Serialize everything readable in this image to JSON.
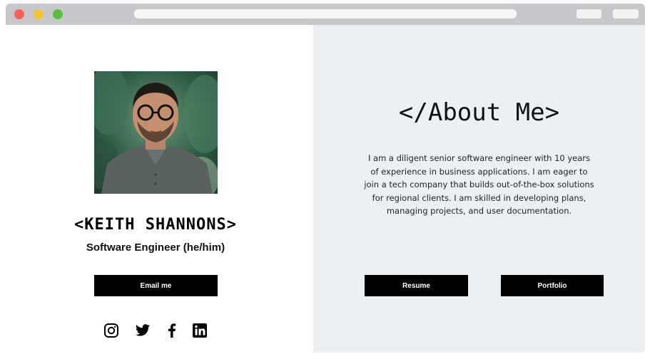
{
  "profile": {
    "name": "<KEITH SHANNONS>",
    "role": "Software Engineer (he/him)",
    "email_button": "Email me",
    "social_icons": [
      "instagram-icon",
      "twitter-icon",
      "facebook-icon",
      "linkedin-icon"
    ]
  },
  "about": {
    "title": "</About Me>",
    "text": "I am a diligent senior software engineer with 10 years of experience in business applications. I am eager to join a tech company that builds out-of-the-box solutions for regional clients. I am skilled in developing plans, managing projects, and user documentation.",
    "resume_button": "Resume",
    "portfolio_button": "Portfolio"
  },
  "colors": {
    "right_panel_bg": "#edf0f3",
    "button_bg": "#000000",
    "button_text": "#ffffff"
  }
}
